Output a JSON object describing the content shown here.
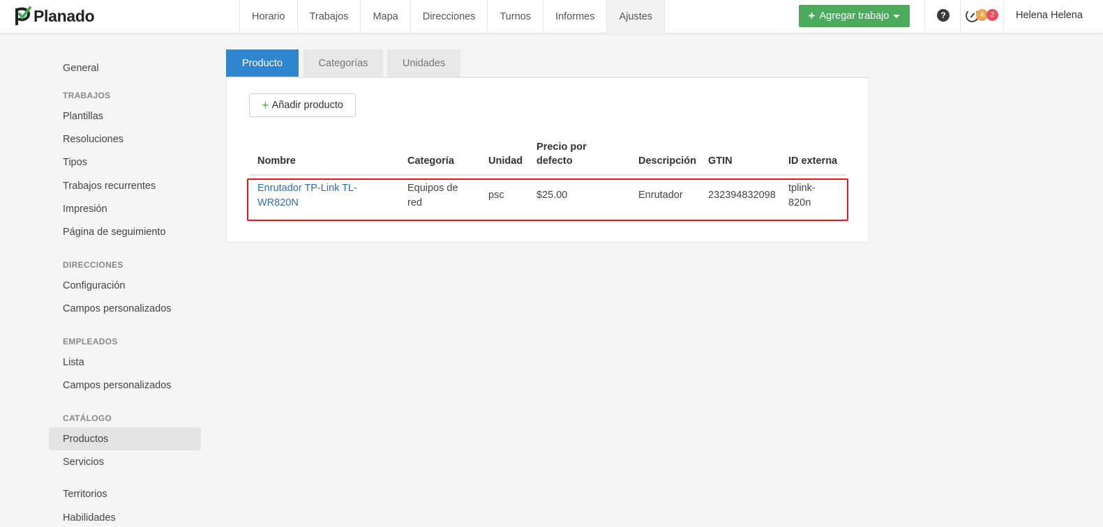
{
  "app": {
    "name": "Planado"
  },
  "nav": {
    "items": [
      "Horario",
      "Trabajos",
      "Mapa",
      "Direcciones",
      "Turnos",
      "Informes",
      "Ajustes"
    ],
    "active": "Ajustes",
    "add_job_label": "Agregar trabajo",
    "help_symbol": "?",
    "badge_orange": "4",
    "badge_red": "2",
    "user_name": "Helena Helena"
  },
  "sidebar": {
    "general": "General",
    "sections": [
      {
        "heading": "TRABAJOS",
        "items": [
          "Plantillas",
          "Resoluciones",
          "Tipos",
          "Trabajos recurrentes",
          "Impresión",
          "Página de seguimiento"
        ]
      },
      {
        "heading": "DIRECCIONES",
        "items": [
          "Configuración",
          "Campos personalizados"
        ]
      },
      {
        "heading": "EMPLEADOS",
        "items": [
          "Lista",
          "Campos personalizados"
        ]
      },
      {
        "heading": "CATÁLOGO",
        "items": [
          "Productos",
          "Servicios"
        ]
      }
    ],
    "extra": [
      "Territorios",
      "Habilidades"
    ],
    "active": "Productos"
  },
  "tabs": [
    "Producto",
    "Categorías",
    "Unidades"
  ],
  "active_tab": "Producto",
  "add_product_label": "Añadir producto",
  "table": {
    "headers": {
      "nombre": "Nombre",
      "categoria": "Categoría",
      "unidad": "Unidad",
      "precio_1": "Precio por",
      "precio_2": "defecto",
      "descripcion": "Descripción",
      "gtin": "GTIN",
      "id_externa": "ID externa"
    },
    "rows": [
      {
        "nombre_1": "Enrutador TP-Link TL-",
        "nombre_2": "WR820N",
        "categoria_1": "Equipos de",
        "categoria_2": "red",
        "unidad": "psc",
        "precio": "$25.00",
        "descripcion": "Enrutador",
        "gtin": "232394832098",
        "id_1": "tplink-",
        "id_2": "820n"
      }
    ]
  },
  "colors": {
    "primary": "#2f86cf",
    "success": "#4caa5c",
    "highlight": "#e8141e"
  }
}
